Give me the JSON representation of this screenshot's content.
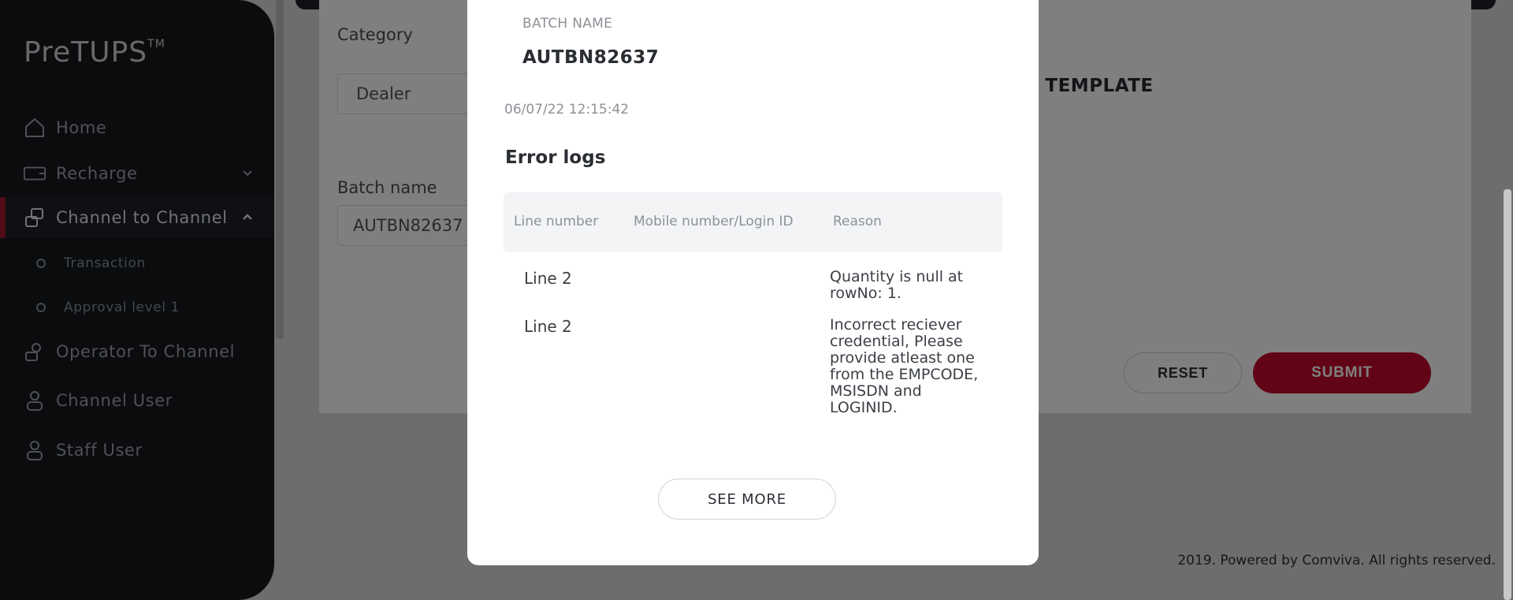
{
  "app": {
    "logo": "PreTUPS",
    "logo_tm": "TM"
  },
  "sidebar": {
    "items": [
      {
        "label": "Home",
        "icon": "home-icon"
      },
      {
        "label": "Recharge",
        "icon": "recharge-icon"
      },
      {
        "label": "Channel to Channel",
        "icon": "channel-icon"
      },
      {
        "label": "Operator To Channel",
        "icon": "operator-icon"
      },
      {
        "label": "Channel User",
        "icon": "user-icon"
      },
      {
        "label": "Staff User",
        "icon": "staff-icon"
      }
    ],
    "sub_items": [
      {
        "label": "Transaction"
      },
      {
        "label": "Approval level 1"
      }
    ]
  },
  "form": {
    "category_label": "Category",
    "category_value": "Dealer",
    "batch_label": "Batch name",
    "batch_value": "AUTBN82637",
    "download_label": "AD TEMPLATE",
    "reset_label": "RESET",
    "submit_label": "SUBMIT"
  },
  "footer": {
    "text": "2019. Powered by Comviva. All rights reserved."
  },
  "modal": {
    "batch_name_label": "BATCH NAME",
    "batch_name_value": "AUTBN82637",
    "timestamp": "06/07/22 12:15:42",
    "title": "Error logs",
    "columns": [
      "Line number",
      "Mobile number/Login ID",
      "Reason"
    ],
    "rows": [
      {
        "line": "Line 2",
        "mobile": "",
        "reason": "Quantity is null at rowNo: 1."
      },
      {
        "line": "Line 2",
        "mobile": "",
        "reason": "Incorrect reciever credential, Please provide atleast one from the EMPCODE, MSISDN and LOGINID."
      }
    ],
    "see_more_label": "SEE MORE"
  },
  "colors": {
    "sidebar_bg": "#15181d",
    "accent": "#c3092c",
    "active_marker": "#a3192f"
  }
}
